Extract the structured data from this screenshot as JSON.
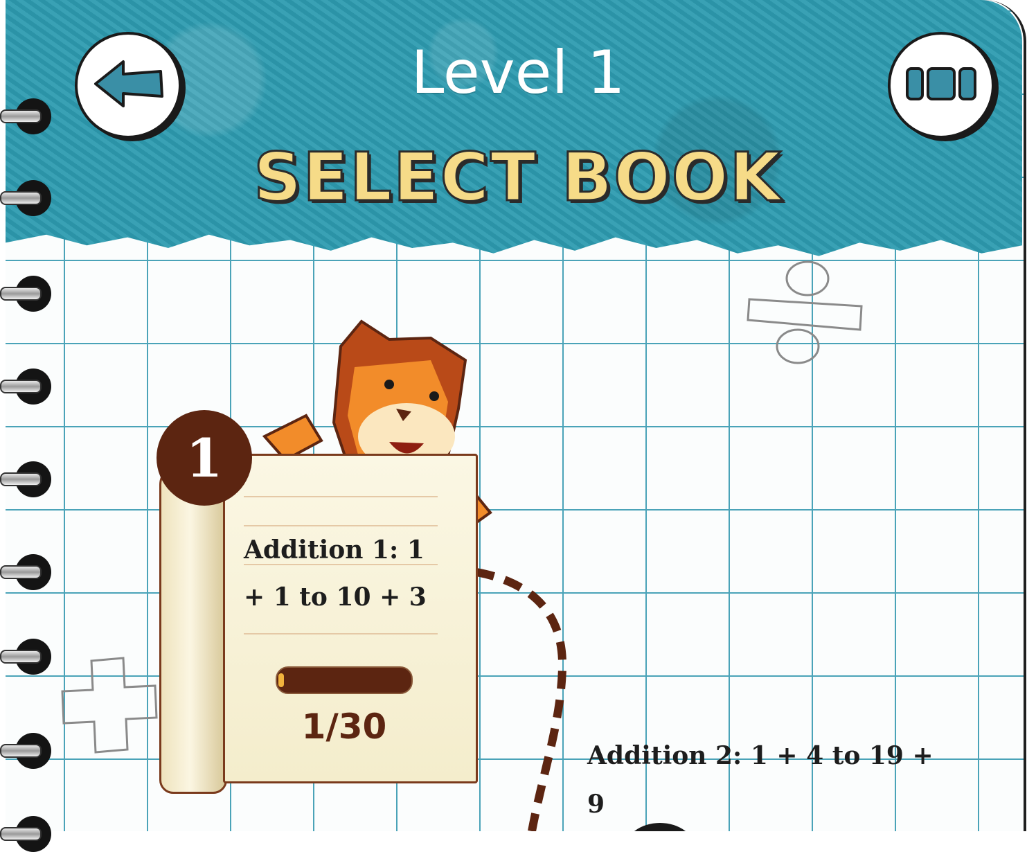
{
  "header": {
    "level_label": "Level 1",
    "title": "SELECT BOOK",
    "back_icon": "back-arrow-icon",
    "menu_icon": "menu-icon"
  },
  "books": [
    {
      "number": "1",
      "title": "Addition 1: 1 + 1 to 10 + 3",
      "progress_label": "1/30",
      "progress": 0.033
    },
    {
      "title": "Addition 2: 1 + 4 to 19 + 9"
    }
  ],
  "colors": {
    "header": "#2d9bb0",
    "title_fill": "#f6db88",
    "badge": "#5c2511",
    "grid": "#4aa3b8"
  }
}
